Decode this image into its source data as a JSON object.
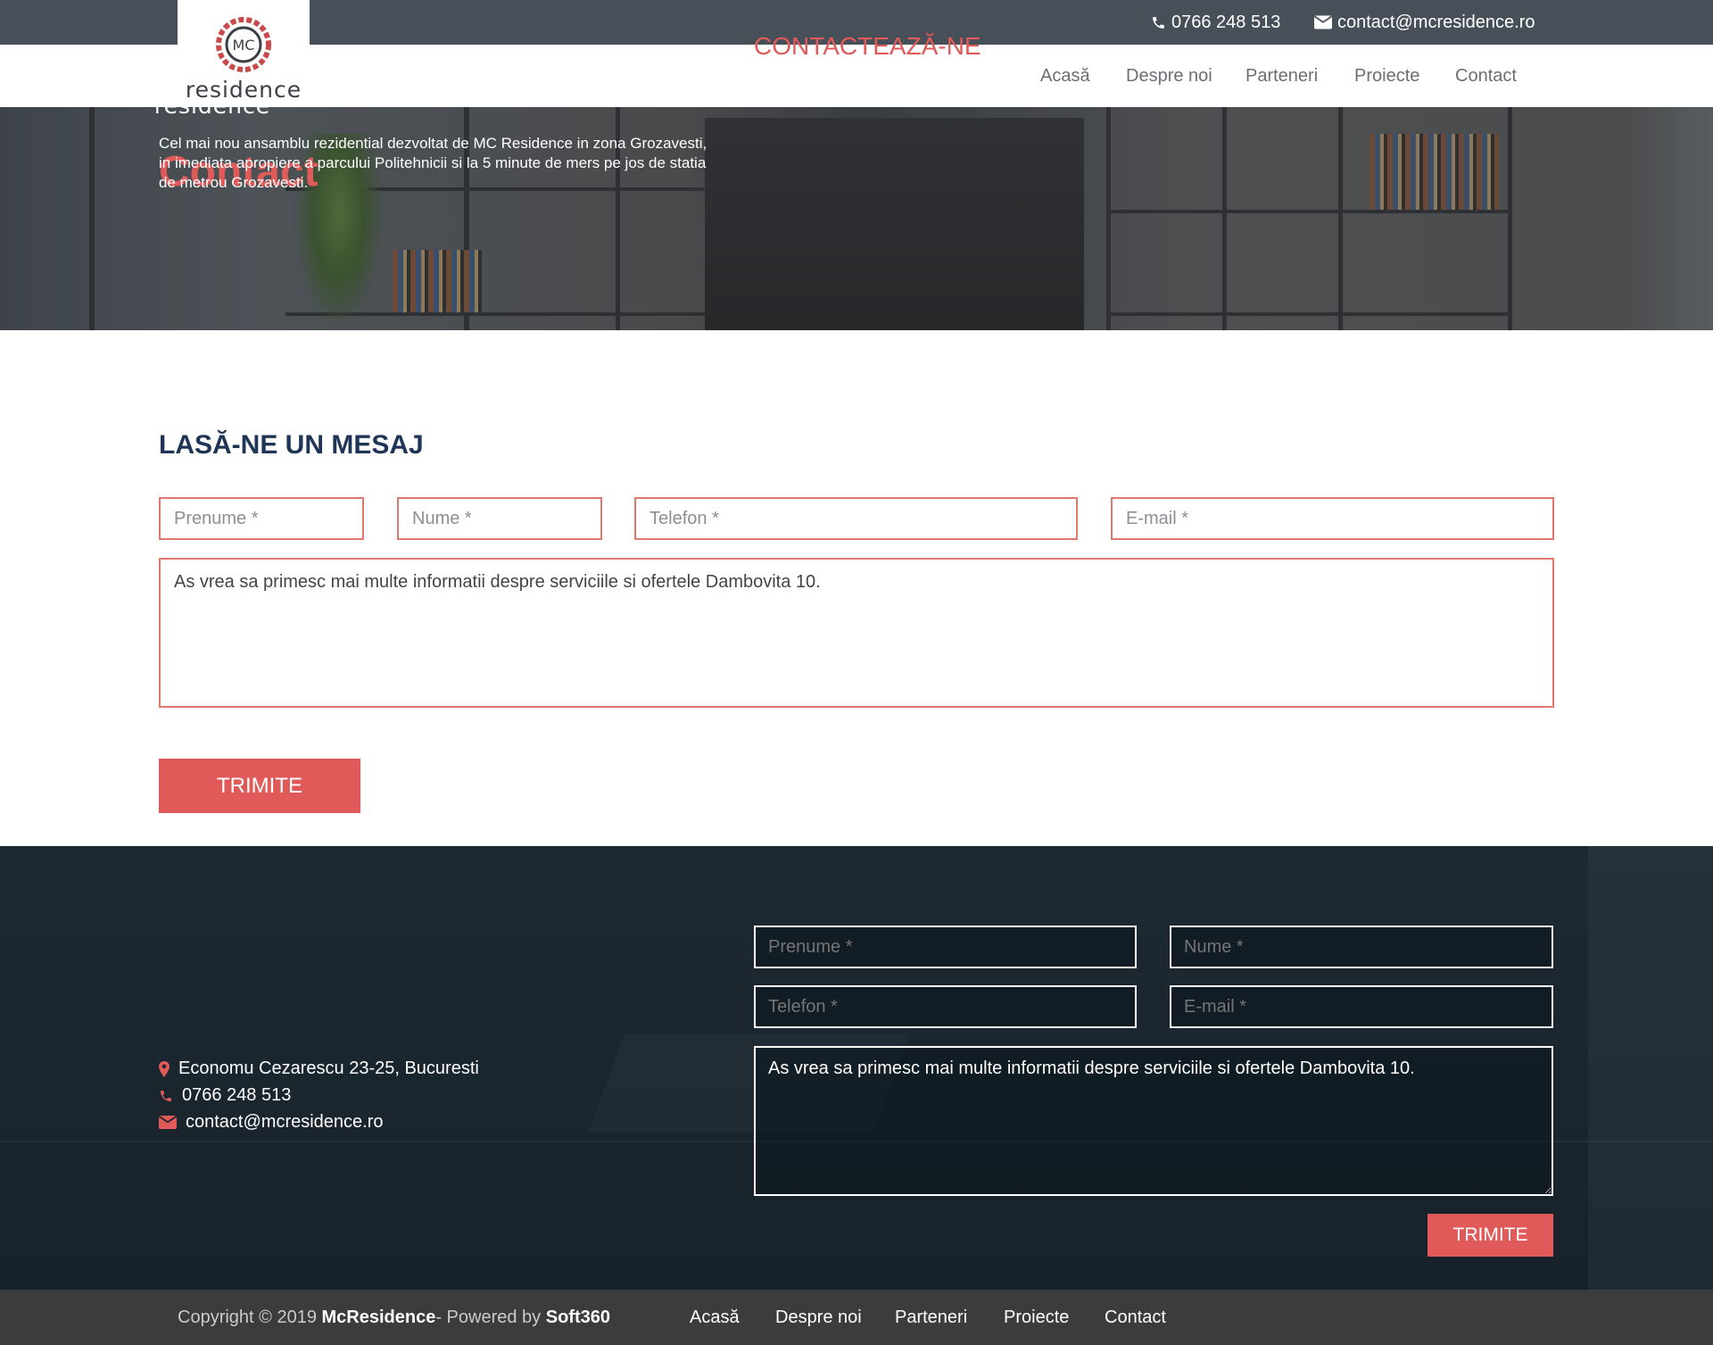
{
  "topbar": {
    "phone": "0766 248 513",
    "email": "contact@mcresidence.ro",
    "phone_icon": "phone-icon",
    "email_icon": "envelope-icon"
  },
  "brand": {
    "logo_mark": "MC",
    "logo_text": "residence",
    "accent_color": "#e05a5a",
    "dark_color": "#1e3556"
  },
  "nav": {
    "items": [
      "Acasă",
      "Despre noi",
      "Parteneri",
      "Proiecte",
      "Contact"
    ]
  },
  "hero": {
    "title": "Contact"
  },
  "message_form": {
    "heading": "LASĂ-NE UN MESAJ",
    "firstname_placeholder": "Prenume *",
    "lastname_placeholder": "Nume *",
    "phone_placeholder": "Telefon *",
    "email_placeholder": "E-mail *",
    "message_value": "As vrea sa primesc mai multe informatii despre serviciile si ofertele Dambovita 10.",
    "submit_label": "TRIMITE"
  },
  "footer": {
    "logo_mark": "MC",
    "logo_text": "residence",
    "description": "Cel mai nou ansamblu rezidential dezvoltat de MC Residence in zona Grozavesti, in imediata apropiere a parcului Politehnicii si la 5 minute de mers pe jos de statia de metrou Grozavesti.",
    "address": "Economu Cezarescu 23-25, Bucuresti",
    "phone": "0766 248 513",
    "email": "contact@mcresidence.ro",
    "address_icon": "map-marker-icon",
    "phone_icon": "phone-icon",
    "email_icon": "envelope-icon",
    "form": {
      "heading": "CONTACTEAZĂ-NE",
      "firstname_placeholder": "Prenume *",
      "lastname_placeholder": "Nume *",
      "phone_placeholder": "Telefon *",
      "email_placeholder": "E-mail *",
      "message_value": "As vrea sa primesc mai multe informatii despre serviciile si ofertele Dambovita 10.",
      "submit_label": "TRIMITE"
    }
  },
  "bottombar": {
    "copyright_prefix": "Copyright © 2019",
    "copyright_brand": "McResidence",
    "powered_prefix": " - Powered by",
    "powered_brand": "Soft360",
    "nav": [
      "Acasă",
      "Despre noi",
      "Parteneri",
      "Proiecte",
      "Contact"
    ]
  }
}
